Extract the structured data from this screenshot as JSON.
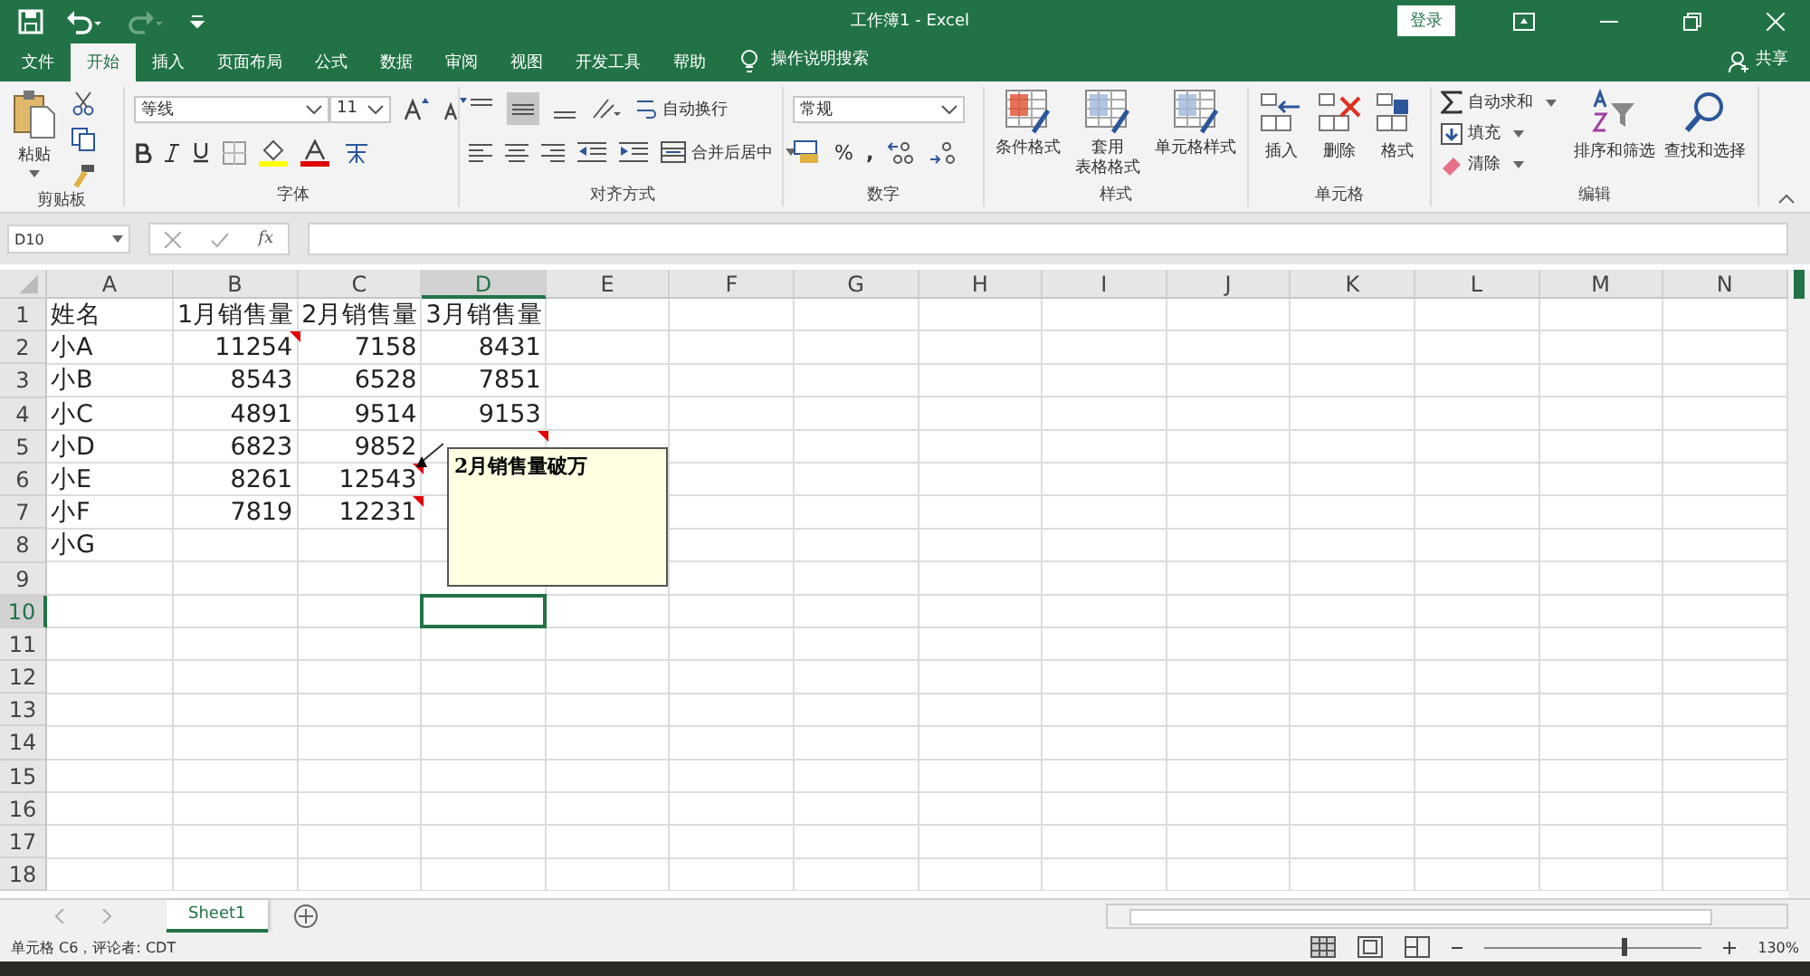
{
  "title_bar": {
    "title": "工作簿1  -  Excel",
    "sign_in": "登录"
  },
  "menu_tabs": [
    {
      "label": "文件",
      "selected": false
    },
    {
      "label": "开始",
      "selected": true
    },
    {
      "label": "插入",
      "selected": false
    },
    {
      "label": "页面布局",
      "selected": false
    },
    {
      "label": "公式",
      "selected": false
    },
    {
      "label": "数据",
      "selected": false
    },
    {
      "label": "审阅",
      "selected": false
    },
    {
      "label": "视图",
      "selected": false
    },
    {
      "label": "开发工具",
      "selected": false
    },
    {
      "label": "帮助",
      "selected": false
    }
  ],
  "tell_me": "操作说明搜索",
  "share": "共享",
  "ribbon": {
    "clipboard": {
      "paste": "粘贴",
      "label": "剪贴板"
    },
    "font": {
      "font_name": "等线",
      "font_size": "11",
      "label": "字体"
    },
    "alignment": {
      "wrap": "自动换行",
      "merge": "合并后居中",
      "label": "对齐方式"
    },
    "number": {
      "format": "常规",
      "percent": "%",
      "comma": ",",
      "label": "数字"
    },
    "styles": {
      "buttons": [
        [
          "条件格式"
        ],
        [
          "套用",
          "表格格式"
        ],
        [
          "单元格样式"
        ]
      ],
      "label": "样式"
    },
    "cells": {
      "buttons": [
        "插入",
        "删除",
        "格式"
      ],
      "label": "单元格"
    },
    "editing": {
      "autosum": "自动求和",
      "fill": "填充",
      "clear": "清除",
      "sort": "排序和筛选",
      "find": "查找和选择",
      "label": "编辑"
    }
  },
  "formula_bar": {
    "name_box": "D10",
    "fx": "fx"
  },
  "columns": [
    {
      "label": "A",
      "selected": false
    },
    {
      "label": "B",
      "selected": false
    },
    {
      "label": "C",
      "selected": false
    },
    {
      "label": "D",
      "selected": true
    },
    {
      "label": "E",
      "selected": false
    },
    {
      "label": "F",
      "selected": false
    },
    {
      "label": "G",
      "selected": false
    },
    {
      "label": "H",
      "selected": false
    },
    {
      "label": "I",
      "selected": false
    },
    {
      "label": "J",
      "selected": false
    },
    {
      "label": "K",
      "selected": false
    },
    {
      "label": "L",
      "selected": false
    },
    {
      "label": "M",
      "selected": false
    },
    {
      "label": "N",
      "selected": false
    }
  ],
  "rows": [
    {
      "number": "1",
      "selected": false,
      "cells": [
        {
          "text": "姓名",
          "comment": false
        },
        {
          "text": "1月销售量",
          "comment": false
        },
        {
          "text": "2月销售量",
          "comment": false
        },
        {
          "text": "3月销售量",
          "comment": false
        }
      ]
    },
    {
      "number": "2",
      "selected": false,
      "cells": [
        {
          "text": "小A",
          "comment": false
        },
        {
          "text": "11254",
          "comment": true
        },
        {
          "text": "7158",
          "comment": false
        },
        {
          "text": "8431",
          "comment": false
        }
      ]
    },
    {
      "number": "3",
      "selected": false,
      "cells": [
        {
          "text": "小B",
          "comment": false
        },
        {
          "text": "8543",
          "comment": false
        },
        {
          "text": "6528",
          "comment": false
        },
        {
          "text": "7851",
          "comment": false
        }
      ]
    },
    {
      "number": "4",
      "selected": false,
      "cells": [
        {
          "text": "小C",
          "comment": false
        },
        {
          "text": "4891",
          "comment": false
        },
        {
          "text": "9514",
          "comment": false
        },
        {
          "text": "9153",
          "comment": false
        }
      ]
    },
    {
      "number": "5",
      "selected": false,
      "cells": [
        {
          "text": "小D",
          "comment": false
        },
        {
          "text": "6823",
          "comment": false
        },
        {
          "text": "9852",
          "comment": false
        },
        {
          "comment": true
        }
      ]
    },
    {
      "number": "6",
      "selected": false,
      "cells": [
        {
          "text": "小E",
          "comment": false
        },
        {
          "text": "8261",
          "comment": false
        },
        {
          "text": "12543",
          "comment": true
        }
      ]
    },
    {
      "number": "7",
      "selected": false,
      "cells": [
        {
          "text": "小F",
          "comment": false
        },
        {
          "text": "7819",
          "comment": false
        },
        {
          "text": "12231",
          "comment": true
        }
      ]
    },
    {
      "number": "8",
      "selected": false,
      "cells": [
        {
          "text": "小G",
          "comment": false
        }
      ]
    },
    {
      "number": "9",
      "selected": false,
      "cells": []
    },
    {
      "number": "10",
      "selected": true,
      "cells": []
    },
    {
      "number": "11",
      "selected": false,
      "cells": []
    },
    {
      "number": "12",
      "selected": false,
      "cells": []
    },
    {
      "number": "13",
      "selected": false,
      "cells": []
    },
    {
      "number": "14",
      "selected": false,
      "cells": []
    },
    {
      "number": "15",
      "selected": false,
      "cells": []
    },
    {
      "number": "16",
      "selected": false,
      "cells": []
    },
    {
      "number": "17",
      "selected": false,
      "cells": []
    },
    {
      "number": "18",
      "selected": false,
      "cells": []
    }
  ],
  "comment_box": {
    "text": "2月销售量破万"
  },
  "sheet_tabs": [
    {
      "label": "Sheet1",
      "selected": true
    }
  ],
  "status_bar": {
    "text": "单元格 C6，评论者: CDT",
    "zoom": "130%",
    "zoom_slider": {
      "level": 0.63
    }
  }
}
